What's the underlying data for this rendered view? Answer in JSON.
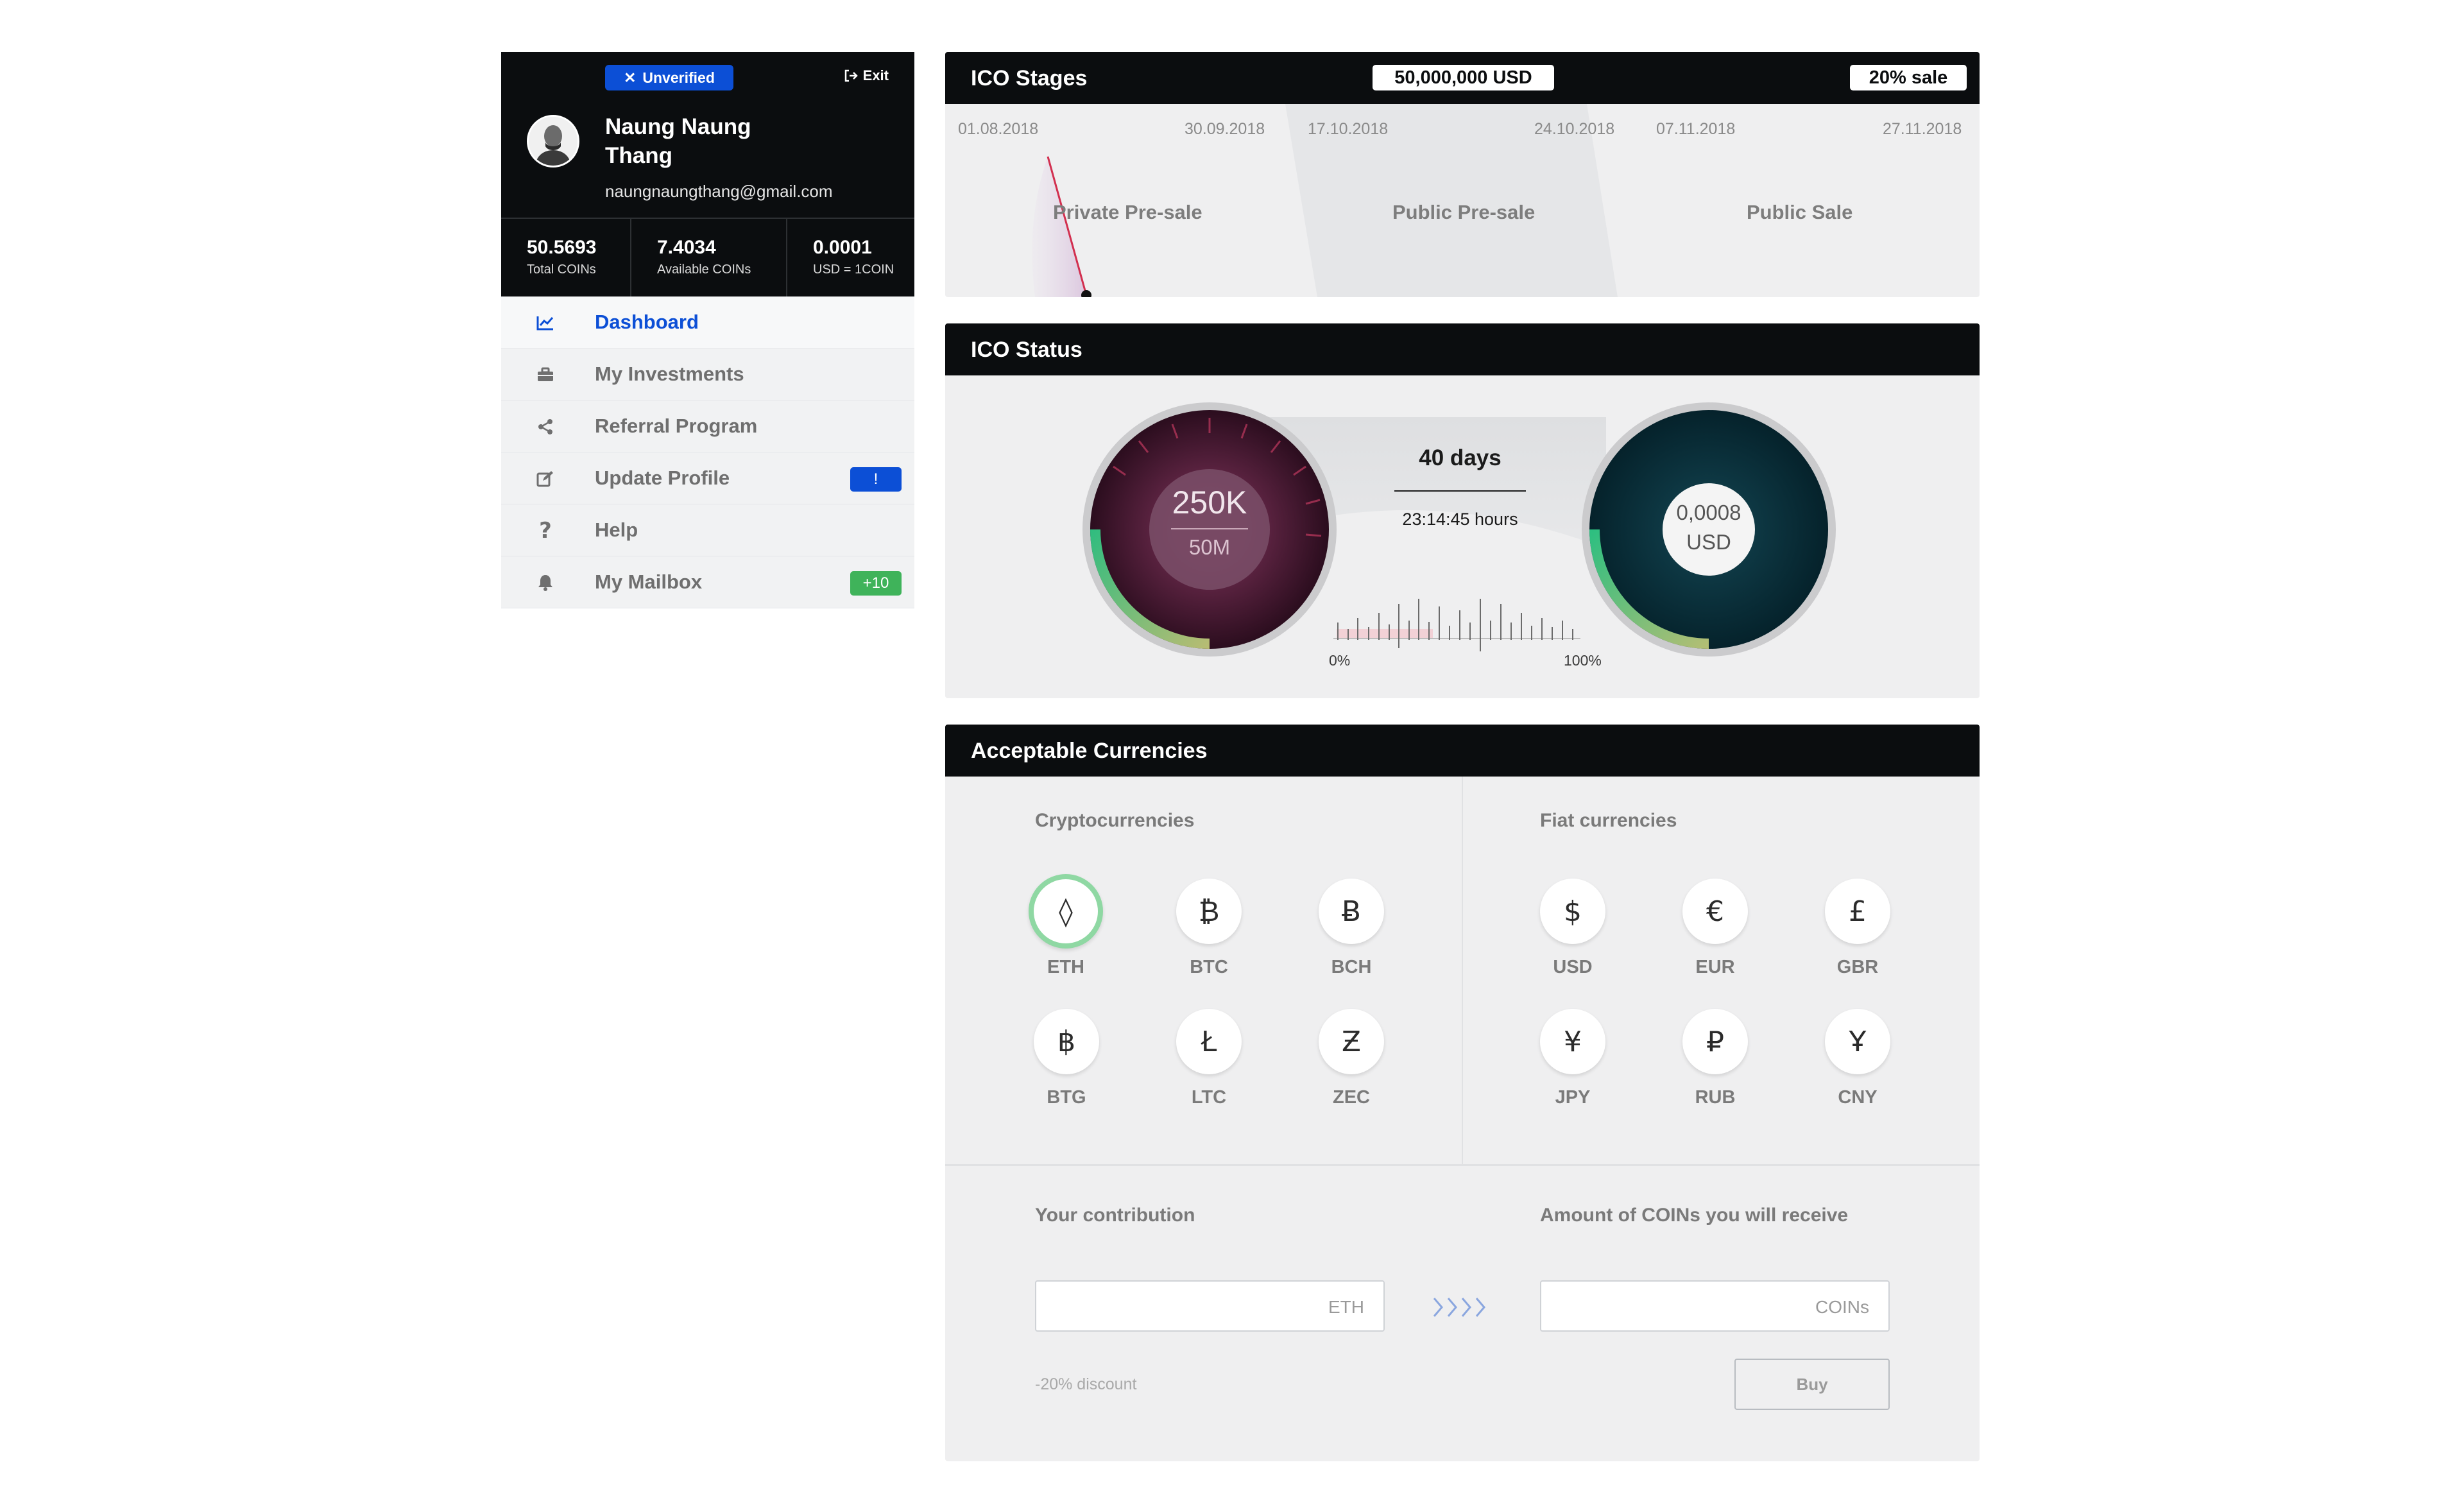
{
  "profile": {
    "status_badge": "Unverified",
    "exit_label": "Exit",
    "name": "Naung Naung Thang",
    "email": "naungnaungthang@gmail.com",
    "stats": [
      {
        "value": "50.5693",
        "label": "Total COINs"
      },
      {
        "value": "7.4034",
        "label": "Available COINs"
      },
      {
        "value": "0.0001",
        "label": "USD = 1COIN"
      }
    ]
  },
  "menu": [
    {
      "label": "Dashboard",
      "icon": "chart-icon",
      "active": true
    },
    {
      "label": "My Investments",
      "icon": "briefcase-icon"
    },
    {
      "label": "Referral Program",
      "icon": "share-icon"
    },
    {
      "label": "Update Profile",
      "icon": "edit-icon",
      "badge": "!"
    },
    {
      "label": "Help",
      "icon": "question-icon"
    },
    {
      "label": "My Mailbox",
      "icon": "bell-icon",
      "badge": "+10"
    }
  ],
  "ico_stages": {
    "title": "ICO Stages",
    "total": "50,000,000 USD",
    "sale": "20% sale",
    "stages": [
      {
        "name": "Private Pre-sale",
        "start": "01.08.2018",
        "end": "30.09.2018"
      },
      {
        "name": "Public Pre-sale",
        "start": "17.10.2018",
        "end": "24.10.2018"
      },
      {
        "name": "Public Sale",
        "start": "07.11.2018",
        "end": "27.11.2018"
      }
    ]
  },
  "ico_status": {
    "title": "ICO Status",
    "raised": "250K",
    "goal": "50M",
    "days": "40 days",
    "time": "23:14:45 hours",
    "progress_min": "0%",
    "progress_max": "100%",
    "price_value": "0,0008",
    "price_unit": "USD"
  },
  "currencies": {
    "title": "Acceptable Currencies",
    "crypto_title": "Cryptocurrencies",
    "fiat_title": "Fiat currencies",
    "crypto": [
      {
        "code": "ETH",
        "symbol": "◊",
        "selected": true
      },
      {
        "code": "BTC",
        "symbol": "₿"
      },
      {
        "code": "BCH",
        "symbol": "Ƀ"
      },
      {
        "code": "BTG",
        "symbol": "฿"
      },
      {
        "code": "LTC",
        "symbol": "Ł"
      },
      {
        "code": "ZEC",
        "symbol": "Ƶ"
      }
    ],
    "fiat": [
      {
        "code": "USD",
        "symbol": "$"
      },
      {
        "code": "EUR",
        "symbol": "€"
      },
      {
        "code": "GBR",
        "symbol": "£"
      },
      {
        "code": "JPY",
        "symbol": "¥"
      },
      {
        "code": "RUB",
        "symbol": "₽"
      },
      {
        "code": "CNY",
        "symbol": "Ұ"
      }
    ],
    "contribution_label": "Your contribution",
    "receive_label": "Amount of COINs you will receive",
    "contribution_unit": "ETH",
    "receive_unit": "COINs",
    "discount": "-20% discount",
    "buy_label": "Buy"
  },
  "colors": {
    "accent": "#0c4fd6",
    "dark": "#0b0d0f",
    "success": "#3fb35a",
    "panel": "#efeff0"
  }
}
